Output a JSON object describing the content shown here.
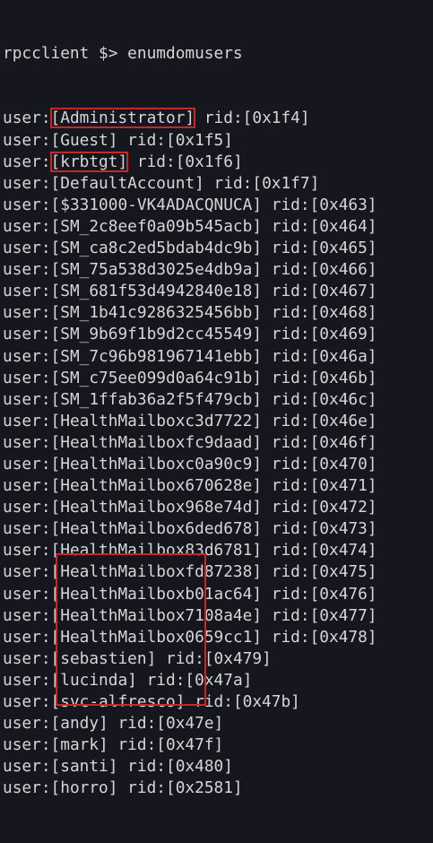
{
  "terminal": {
    "prompt": "rpcclient $> enumdomusers",
    "highlight_color": "#c62828",
    "entries": [
      {
        "user": "Administrator",
        "rid": "0x1f4",
        "boxed": true
      },
      {
        "user": "Guest",
        "rid": "0x1f5",
        "boxed": false
      },
      {
        "user": "krbtgt",
        "rid": "0x1f6",
        "boxed": true
      },
      {
        "user": "DefaultAccount",
        "rid": "0x1f7",
        "boxed": false
      },
      {
        "user": "$331000-VK4ADACQNUCA",
        "rid": "0x463",
        "boxed": false
      },
      {
        "user": "SM_2c8eef0a09b545acb",
        "rid": "0x464",
        "boxed": false
      },
      {
        "user": "SM_ca8c2ed5bdab4dc9b",
        "rid": "0x465",
        "boxed": false
      },
      {
        "user": "SM_75a538d3025e4db9a",
        "rid": "0x466",
        "boxed": false
      },
      {
        "user": "SM_681f53d4942840e18",
        "rid": "0x467",
        "boxed": false
      },
      {
        "user": "SM_1b41c9286325456bb",
        "rid": "0x468",
        "boxed": false
      },
      {
        "user": "SM_9b69f1b9d2cc45549",
        "rid": "0x469",
        "boxed": false
      },
      {
        "user": "SM_7c96b981967141ebb",
        "rid": "0x46a",
        "boxed": false
      },
      {
        "user": "SM_c75ee099d0a64c91b",
        "rid": "0x46b",
        "boxed": false
      },
      {
        "user": "SM_1ffab36a2f5f479cb",
        "rid": "0x46c",
        "boxed": false
      },
      {
        "user": "HealthMailboxc3d7722",
        "rid": "0x46e",
        "boxed": false
      },
      {
        "user": "HealthMailboxfc9daad",
        "rid": "0x46f",
        "boxed": false
      },
      {
        "user": "HealthMailboxc0a90c9",
        "rid": "0x470",
        "boxed": false
      },
      {
        "user": "HealthMailbox670628e",
        "rid": "0x471",
        "boxed": false
      },
      {
        "user": "HealthMailbox968e74d",
        "rid": "0x472",
        "boxed": false
      },
      {
        "user": "HealthMailbox6ded678",
        "rid": "0x473",
        "boxed": false
      },
      {
        "user": "HealthMailbox83d6781",
        "rid": "0x474",
        "boxed": false
      },
      {
        "user": "HealthMailboxfd87238",
        "rid": "0x475",
        "boxed": false
      },
      {
        "user": "HealthMailboxb01ac64",
        "rid": "0x476",
        "boxed": false
      },
      {
        "user": "HealthMailbox7108a4e",
        "rid": "0x477",
        "boxed": false
      },
      {
        "user": "HealthMailbox0659cc1",
        "rid": "0x478",
        "boxed": false
      },
      {
        "user": "sebastien",
        "rid": "0x479",
        "boxed": false
      },
      {
        "user": "lucinda",
        "rid": "0x47a",
        "boxed": false
      },
      {
        "user": "svc-alfresco",
        "rid": "0x47b",
        "boxed": false
      },
      {
        "user": "andy",
        "rid": "0x47e",
        "boxed": false
      },
      {
        "user": "mark",
        "rid": "0x47f",
        "boxed": false
      },
      {
        "user": "santi",
        "rid": "0x480",
        "boxed": false
      },
      {
        "user": "horro",
        "rid": "0x2581",
        "boxed": false
      }
    ]
  }
}
